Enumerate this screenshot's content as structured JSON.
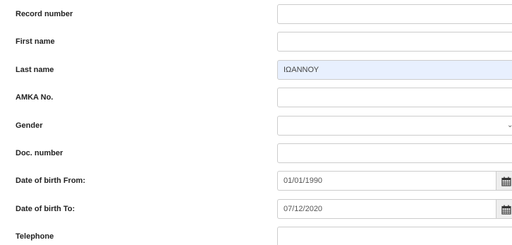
{
  "fields": {
    "record_number": {
      "label": "Record number",
      "value": ""
    },
    "first_name": {
      "label": "First name",
      "value": ""
    },
    "last_name": {
      "label": "Last name",
      "value": "ΙΩΑΝΝΟΥ"
    },
    "amka": {
      "label": "AMKA No.",
      "value": ""
    },
    "gender": {
      "label": "Gender",
      "value": ""
    },
    "doc_number": {
      "label": "Doc. number",
      "value": ""
    },
    "dob_from": {
      "label": "Date of birth From:",
      "value": "01/01/1990"
    },
    "dob_to": {
      "label": "Date of birth To:",
      "value": "07/12/2020"
    },
    "telephone": {
      "label": "Telephone",
      "value": ""
    }
  },
  "icons": {
    "select_chevron": "chevron-down-icon",
    "date_picker": "calendar-icon"
  },
  "colors": {
    "autofill_background": "#e8f0fe",
    "border": "#cccccc",
    "label_text": "#222222"
  }
}
